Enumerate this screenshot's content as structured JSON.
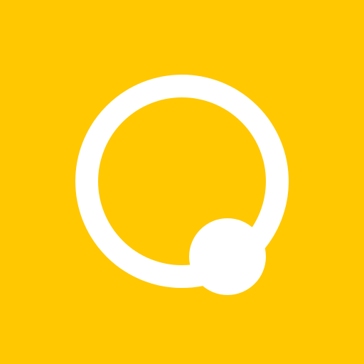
{
  "icon": {
    "name": "ring-with-dot-logo",
    "background_color": "#FFC800",
    "foreground_color": "#FFFFFF"
  }
}
